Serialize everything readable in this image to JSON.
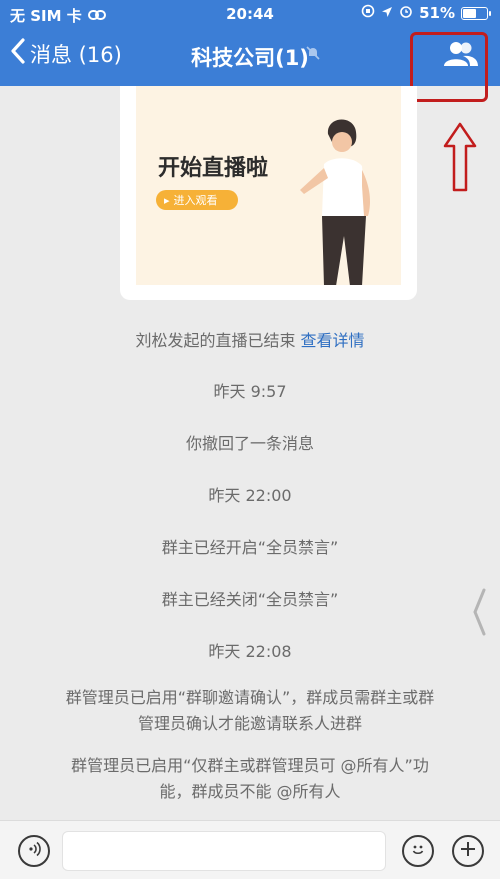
{
  "status_bar": {
    "carrier": "无 SIM 卡",
    "time": "20:44",
    "battery": "51%"
  },
  "nav": {
    "back_label": "消息 (16)",
    "title": "科技公司(1)",
    "members_icon": "group-icon",
    "mute_icon": "bell-off-icon"
  },
  "live_card": {
    "title": "开始直播啦",
    "button_label": "进入观看"
  },
  "messages": [
    {
      "text": "刘松发起的直播已结束",
      "link": "查看详情"
    },
    {
      "text": "昨天 9:57"
    },
    {
      "text": "你撤回了一条消息"
    },
    {
      "text": "昨天 22:00"
    },
    {
      "text": "群主已经开启“全员禁言”"
    },
    {
      "text": "群主已经关闭“全员禁言”"
    },
    {
      "text": "昨天 22:08"
    },
    {
      "text_line1": "群管理员已启用“群聊邀请确认”，群成员需群主或群",
      "text_line2": "管理员确认才能邀请联系人进群"
    },
    {
      "text_line1": "群管理员已启用“仅群主或群管理员可 @所有人”功",
      "text_line2": "能，群成员不能 @所有人"
    }
  ],
  "input_bar": {
    "placeholder": ""
  },
  "colors": {
    "nav_blue": "#3c7ed6",
    "highlight_red": "#c21d1d",
    "link_blue": "#2f6fc2"
  }
}
